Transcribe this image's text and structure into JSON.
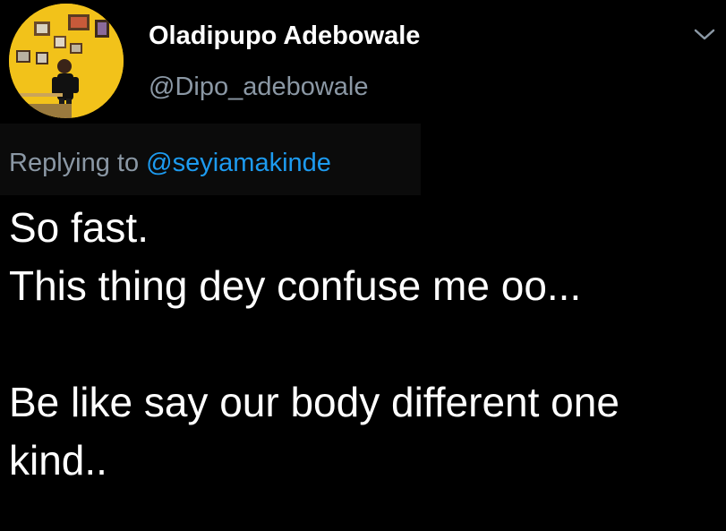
{
  "author": {
    "display_name": "Oladipupo Adebowale",
    "handle": "@Dipo_adebowale",
    "avatar_icon": "profile-photo"
  },
  "menu": {
    "icon": "chevron-down-icon"
  },
  "reply": {
    "prefix": "Replying to ",
    "mention": "@seyiamakinde"
  },
  "tweet": {
    "lines": [
      "So fast.",
      "This thing dey confuse me oo...",
      "",
      "Be like say our body different one",
      "kind.."
    ]
  },
  "colors": {
    "background": "#000000",
    "primary_text": "#ffffff",
    "secondary_text": "#8b98a5",
    "link": "#1d9bf0",
    "avatar_bg": "#f2c21a"
  }
}
